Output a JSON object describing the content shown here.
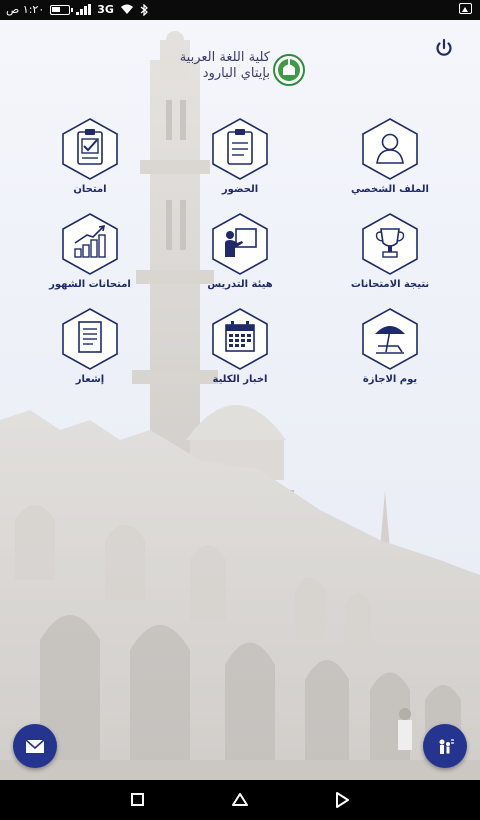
{
  "status_bar": {
    "time": "١:٢٠ ص",
    "network": "3G"
  },
  "header": {
    "college_line1": "كلية اللغة العربية",
    "college_line2": "بإيتاي البارود"
  },
  "tiles": [
    {
      "label": "الملف الشخصي",
      "icon": "profile-icon"
    },
    {
      "label": "الحضور",
      "icon": "attendance-icon"
    },
    {
      "label": "امتحان",
      "icon": "exam-icon"
    },
    {
      "label": "نتيجة الامتحانات",
      "icon": "trophy-icon"
    },
    {
      "label": "هيئة التدريس",
      "icon": "teacher-icon"
    },
    {
      "label": "امتحانات الشهور",
      "icon": "chart-icon"
    },
    {
      "label": "يوم الاجازة",
      "icon": "beach-icon"
    },
    {
      "label": "اخبار الكلية",
      "icon": "calendar-icon"
    },
    {
      "label": "إشعار",
      "icon": "notice-icon"
    }
  ],
  "colors": {
    "accent": "#25348f",
    "label": "#1f2a6b",
    "hex_border": "#1f2a6b"
  }
}
